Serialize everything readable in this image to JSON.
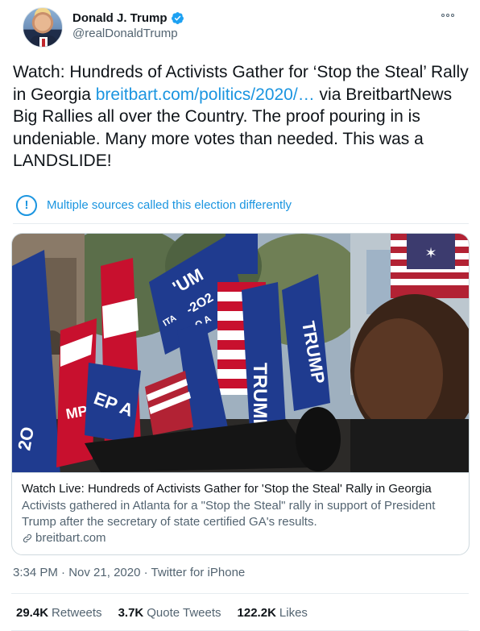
{
  "user": {
    "display_name": "Donald J. Trump",
    "handle": "@realDonaldTrump",
    "verified_icon": "verified-badge-icon",
    "verified_color": "#1da1f2"
  },
  "tweet": {
    "text_before_link": "Watch: Hundreds of Activists Gather for ‘Stop the Steal’ Rally in Georgia ",
    "link_text": "breitbart.com/politics/2020/…",
    "text_after_link": " via BreitbartNews  Big Rallies all over the Country. The proof pouring in is undeniable. Many more votes than needed. This was a LANDSLIDE!"
  },
  "notice": {
    "icon": "exclamation-circle-icon",
    "text": "Multiple sources called this election differently"
  },
  "card": {
    "title": "Watch Live: Hundreds of Activists Gather for 'Stop the Steal' Rally in Georgia",
    "description": "Activists gathered in Atlanta for a \"Stop the Steal\" rally in support of President Trump after the secretary of state certified GA's results.",
    "domain": "breitbart.com",
    "image_flag_texts": [
      "'UM",
      "-2O2",
      "O A",
      "ITA",
      "TRUMP",
      "MP",
      "EP A",
      "TRUMP",
      "2O"
    ]
  },
  "meta": {
    "time": "3:34 PM",
    "separator": "·",
    "date": "Nov 21, 2020",
    "source": "Twitter for iPhone"
  },
  "stats": {
    "retweets_count": "29.4K",
    "retweets_label": "Retweets",
    "quotes_count": "3.7K",
    "quotes_label": "Quote Tweets",
    "likes_count": "122.2K",
    "likes_label": "Likes"
  },
  "colors": {
    "link": "#1b95e0",
    "text": "#0f1419",
    "secondary": "#536471",
    "border": "#cfd9de"
  }
}
